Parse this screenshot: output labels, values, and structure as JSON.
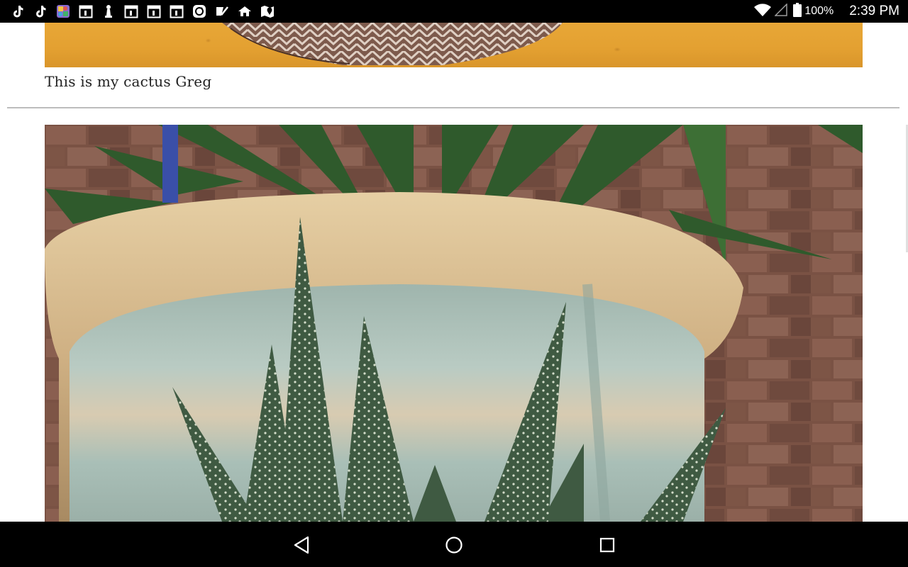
{
  "status_bar": {
    "notification_icons": [
      "tiktok-icon",
      "tiktok-icon",
      "colorful-app-icon",
      "calendar-icon",
      "chess-pawn-icon",
      "calendar-icon",
      "calendar-icon",
      "calendar-icon",
      "sync-app-icon",
      "checkmark-app-icon",
      "home-app-icon",
      "google-maps-icon"
    ],
    "battery_percent": "100%",
    "time": "2:39 PM"
  },
  "post": {
    "caption": "This is my cactus Greg"
  },
  "navigation": {
    "back": "back-icon",
    "home": "home-icon",
    "recents": "recents-icon"
  },
  "colors": {
    "status_bar_bg": "#000000",
    "nav_bar_bg": "#000000",
    "divider": "#bdbdbd",
    "caption_text": "#222222"
  }
}
